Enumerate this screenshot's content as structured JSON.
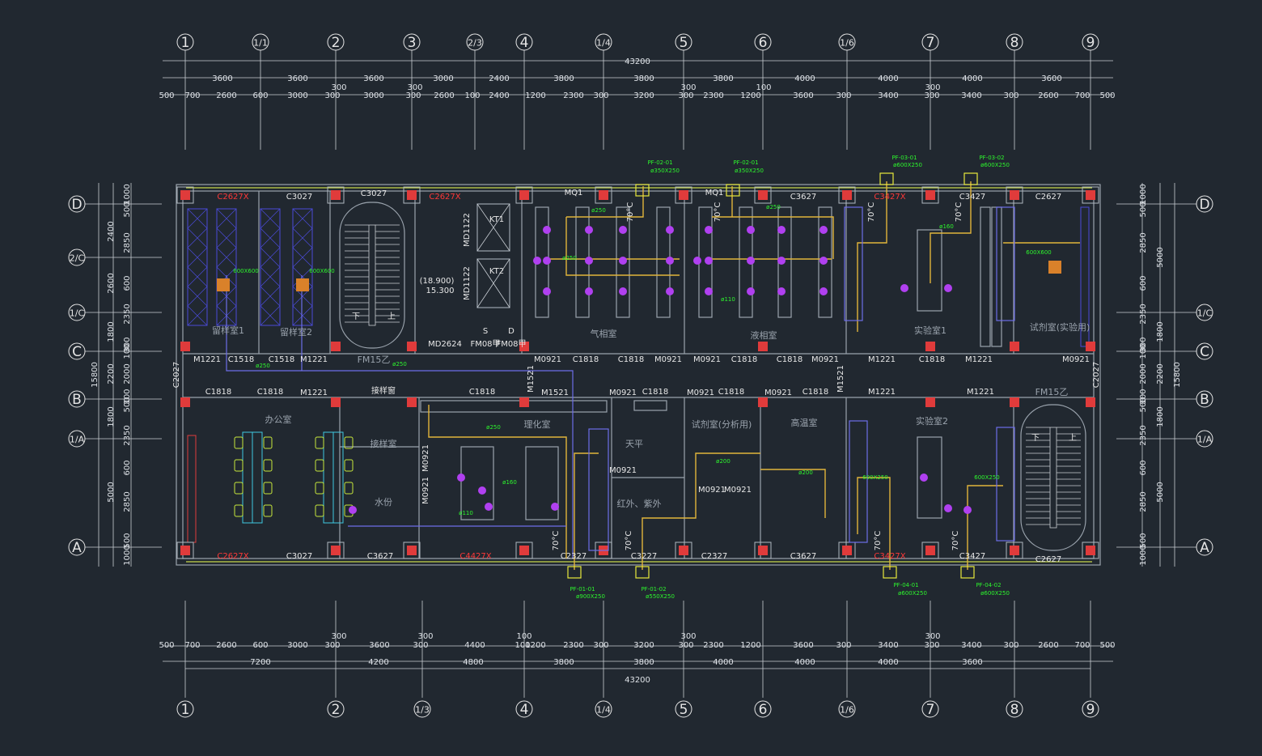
{
  "colors": {
    "background": "#212830",
    "window_red": "#ff3838",
    "note_green": "#2df52d",
    "duct_yellow": "#e1b53b",
    "duct_blue": "#6d6de8",
    "diffuser_purple": "#b040f0",
    "column_red": "#e03b3b"
  },
  "total_dim": "43200",
  "top_dims_outer": [
    "3600",
    "3600",
    "3600",
    "3000",
    "2400",
    "3800",
    "3800",
    "3800",
    "4000",
    "4000",
    "4000",
    "3600"
  ],
  "top_dims_inner": [
    "500",
    "700",
    "2600",
    "600",
    "3000",
    "300",
    "3000",
    "300",
    "2600",
    "100",
    "2400",
    "1200",
    "2300",
    "300",
    "3200",
    "300",
    "2300",
    "1200",
    "3600",
    "300",
    "3400",
    "300",
    "3400",
    "300",
    "2600",
    "700",
    "500"
  ],
  "top_dims_tags": [
    "300",
    "300",
    "100",
    "300",
    "300"
  ],
  "top_axes": [
    "1",
    "1/1",
    "2",
    "3",
    "2/3",
    "4",
    "1/4",
    "5",
    "6",
    "1/6",
    "7",
    "8",
    "9"
  ],
  "bottom_dims_outer": [
    "7200",
    "4200",
    "4800",
    "3800",
    "3800",
    "4000",
    "4000",
    "4000",
    "3600"
  ],
  "bottom_dims_inner": [
    "500",
    "700",
    "2600",
    "600",
    "3000",
    "300",
    "3600",
    "300",
    "4400",
    "100",
    "1200",
    "2300",
    "300",
    "3200",
    "300",
    "2300",
    "1200",
    "3600",
    "300",
    "3400",
    "300",
    "3400",
    "300",
    "2600",
    "700",
    "500"
  ],
  "bottom_dims_tags": [
    "300",
    "300",
    "100",
    "300",
    "300"
  ],
  "bottom_axes": [
    "1",
    "2",
    "1/3",
    "4",
    "1/4",
    "5",
    "6",
    "1/6",
    "7",
    "8",
    "9"
  ],
  "left_axes": [
    "D",
    "2/C",
    "1/C",
    "C",
    "B",
    "1/A",
    "A"
  ],
  "right_axes": [
    "D",
    "1/C",
    "C",
    "B",
    "1/A",
    "A"
  ],
  "left_dims_a": [
    "1000",
    "500",
    "2850",
    "600",
    "2350",
    "300",
    "100",
    "2000",
    "100",
    "500",
    "2350",
    "600",
    "2850",
    "500",
    "1000"
  ],
  "left_dims_b": [
    "2400",
    "2600",
    "1800",
    "2200",
    "1800",
    "5000"
  ],
  "left_total": "15800",
  "right_dims_a": [
    "1000",
    "500",
    "2850",
    "600",
    "2350",
    "300",
    "100",
    "2000",
    "100",
    "500",
    "2350",
    "600",
    "2850",
    "500",
    "1000"
  ],
  "right_dims_b": [
    "5000",
    "1800",
    "2200",
    "1800",
    "5000"
  ],
  "right_total": "15800",
  "windows_top": [
    "C2627X",
    "C3027",
    "C3027",
    "C2627X",
    "MQ1",
    "MQ1",
    "C3627",
    "C3427X",
    "C3427",
    "C2627"
  ],
  "windows_top_red": [
    true,
    false,
    false,
    true,
    false,
    false,
    false,
    true,
    false,
    false
  ],
  "windows_bottom": [
    "C2627X",
    "C3027",
    "C3627",
    "C4427X",
    "C2327",
    "C3227",
    "C2327",
    "C3627",
    "C3427X",
    "C3427",
    "C2627"
  ],
  "windows_bottom_red": [
    true,
    false,
    false,
    true,
    false,
    false,
    false,
    false,
    true,
    false,
    false
  ],
  "doors_upper": [
    "M1221",
    "C1518",
    "C1518",
    "M1221",
    "M0921",
    "C1818",
    "C1818",
    "M0921",
    "M0921",
    "C1818",
    "C1818",
    "M0921",
    "M1221",
    "C1818",
    "M1221",
    "M0921"
  ],
  "doors_lower": [
    "C1818",
    "C1818",
    "M1221",
    "C1818",
    "M1521",
    "M0921",
    "C1818",
    "M0921",
    "C1818",
    "M0921",
    "C1818",
    "M1221",
    "M1221"
  ],
  "side_labels": [
    "C2027",
    "C2027",
    "M1521",
    "M1521",
    "MD1122",
    "MD1122",
    "KT1",
    "KT2",
    "MD2624",
    "FM08甲",
    "FM08甲",
    "S",
    "D",
    "FM15乙",
    "FM15乙",
    "M0921",
    "M0921",
    "M0921",
    "M0921",
    "M0921"
  ],
  "elevation": [
    "(18.900)",
    "15.300"
  ],
  "stairs": [
    "下",
    "上"
  ],
  "rooms_upper": [
    "留样室1",
    "留样室2",
    "气相室",
    "液相室",
    "实验室1",
    "试剂室(实验用)"
  ],
  "rooms_lower": [
    "办公室",
    "接样室",
    "水份",
    "理化室",
    "天平",
    "红外、紫外",
    "试剂室(分析用)",
    "高温室",
    "实验室2",
    "接样窗"
  ],
  "temp_tags": [
    "70°C",
    "70°C",
    "70°C",
    "70°C",
    "70°C",
    "70°C",
    "70°C",
    "70°C"
  ],
  "fan_tags_top": [
    "PF-02-01",
    "PF-02-01",
    "PF-03-01",
    "PF-03-02"
  ],
  "fan_sizes_top": [
    "ø350X250",
    "ø350X250",
    "ø600X250",
    "ø600X250"
  ],
  "fan_tags_bottom": [
    "PF-01-01",
    "PF-01-02",
    "PF-04-01",
    "PF-04-02"
  ],
  "fan_sizes_bottom": [
    "ø900X250",
    "ø550X250",
    "ø600X250",
    "ø600X250"
  ],
  "duct_notes": [
    "ø250",
    "ø250",
    "ø250",
    "ø250",
    "ø250",
    "ø250",
    "ø110",
    "ø110",
    "ø160",
    "ø160",
    "ø200",
    "ø200",
    "600X600",
    "600X600",
    "600X600",
    "600X250",
    "600X250"
  ]
}
